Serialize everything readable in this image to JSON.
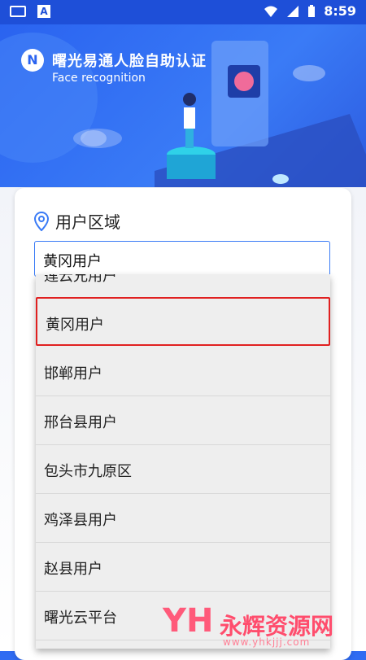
{
  "statusbar": {
    "time": "8:59",
    "icons": [
      "keyboard-icon",
      "a-icon",
      "wifi-icon",
      "signal-icon",
      "battery-icon"
    ]
  },
  "header": {
    "title": "曙光易通人脸自助认证",
    "subtitle": "Face recognition",
    "logo_letter": "N"
  },
  "form": {
    "region_label": "用户区域",
    "selected_value": "黄冈用户"
  },
  "dropdown": {
    "partial_top": "莲云兄用户",
    "options": [
      "黄冈用户",
      "邯郸用户",
      "邢台县用户",
      "包头市九原区",
      "鸡泽县用户",
      "赵县用户",
      "曙光云平台"
    ]
  },
  "watermark": {
    "logo": "YH",
    "name": "永辉资源网",
    "url": "www.yhkjjj.com"
  },
  "colors": {
    "primary": "#2a63f0",
    "selection_border": "#e02020",
    "watermark": "#ff4d6d"
  }
}
